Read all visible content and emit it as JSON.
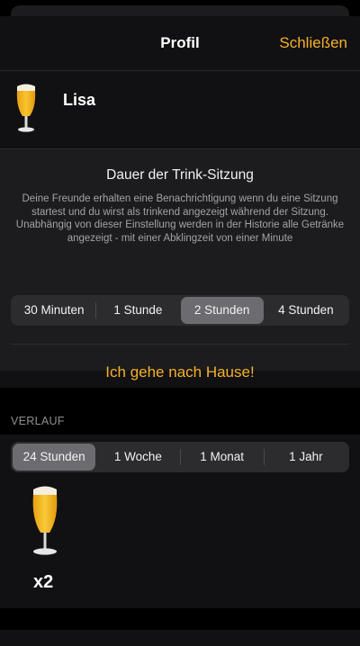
{
  "nav": {
    "title": "Profil",
    "close_label": "Schließen"
  },
  "profile": {
    "name": "Lisa",
    "avatar_icon": "beer-glass-icon"
  },
  "session": {
    "title": "Dauer der Trink-Sitzung",
    "description": "Deine Freunde erhalten eine Benachrichtigung wenn du eine Sitzung startest und du wirst als trinkend angezeigt während der Sitzung. Unabhängig von dieser Einstellung werden in der Historie alle Getränke angezeigt - mit einer Abklingzeit von einer Minute",
    "durations": [
      "30 Minuten",
      "1 Stunde",
      "2 Stunden",
      "4 Stunden"
    ],
    "selected_duration": "2 Stunden",
    "home_button": "Ich gehe nach Hause!"
  },
  "history": {
    "header": "VERLAUF",
    "ranges": [
      "24 Stunden",
      "1 Woche",
      "1 Monat",
      "1 Jahr"
    ],
    "selected_range": "24 Stunden",
    "items": [
      {
        "icon": "beer-glass-icon",
        "count": "x2"
      }
    ]
  },
  "colors": {
    "accent": "#f6b12c",
    "background": "#000000",
    "card": "#1c1c1e",
    "selected_segment": "#6b6b70"
  }
}
